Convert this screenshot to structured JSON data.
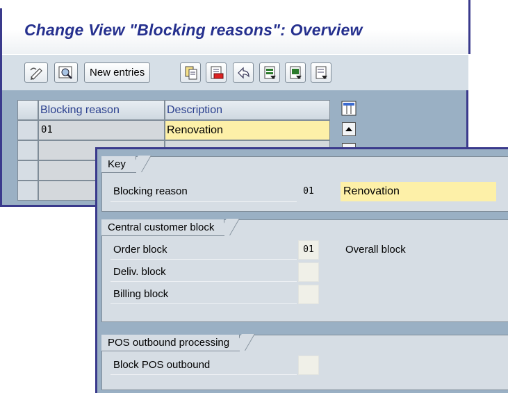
{
  "back": {
    "title": "Change View \"Blocking reasons\": Overview",
    "toolbar": {
      "new_entries": "New entries"
    },
    "table": {
      "headers": [
        "Blocking reason",
        "Description"
      ],
      "rows": [
        {
          "code": "01",
          "description": "Renovation"
        }
      ]
    }
  },
  "front": {
    "key": {
      "title": "Key",
      "label": "Blocking reason",
      "code": "01",
      "description": "Renovation"
    },
    "central": {
      "title": "Central customer block",
      "order_label": "Order block",
      "order_value": "01",
      "order_text": "Overall block",
      "deliv_label": "Deliv. block",
      "billing_label": "Billing block"
    },
    "pos": {
      "title": "POS outbound processing",
      "label": "Block POS outbound"
    }
  },
  "colors": {
    "title": "#25308e",
    "frame": "#3a3a8c",
    "highlight": "#fdf0a8",
    "panel": "#d6dde4"
  },
  "icons": [
    "edit-pencil-icon",
    "display-icon",
    "copy-icon",
    "delete-icon",
    "undo-icon",
    "select-all-icon",
    "select-block-icon",
    "deselect-icon",
    "table-settings-icon",
    "scroll-up-icon",
    "scroll-down-icon"
  ]
}
